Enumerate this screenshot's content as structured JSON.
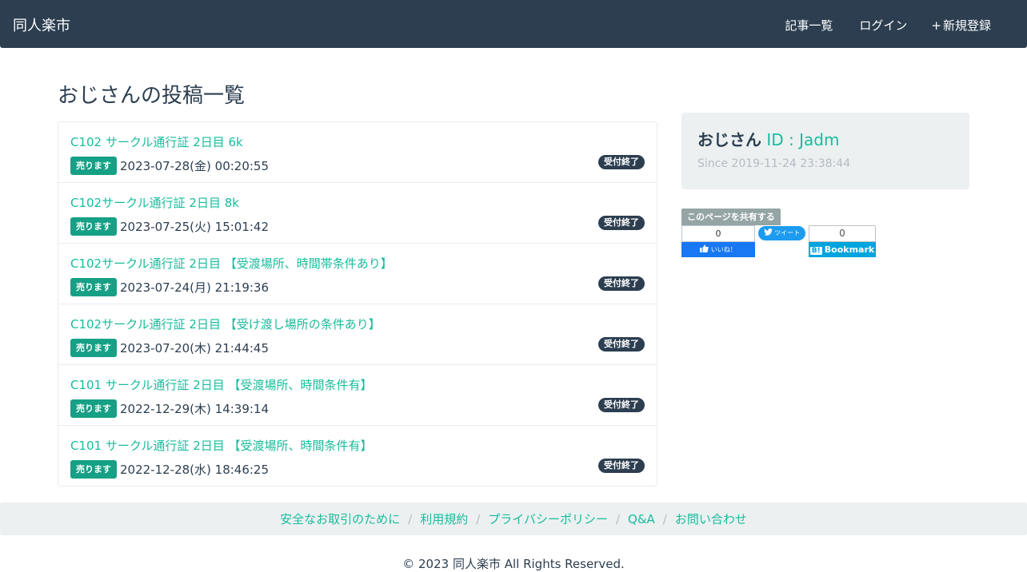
{
  "navbar": {
    "brand": "同人楽市",
    "items": [
      {
        "icon": "",
        "label": "記事一覧"
      },
      {
        "icon": "",
        "label": "ログイン"
      },
      {
        "icon": "+",
        "label": "新規登録"
      }
    ]
  },
  "page_title": "おじさんの投稿一覧",
  "posts": [
    {
      "title": "C102 サークル通行証 2日目 6k",
      "type_badge": "売ります",
      "date": "2023-07-28(金) 00:20:55",
      "status": "受付終了"
    },
    {
      "title": "C102サークル通行証 2日目 8k",
      "type_badge": "売ります",
      "date": "2023-07-25(火) 15:01:42",
      "status": "受付終了"
    },
    {
      "title": "C102サークル通行証 2日目 【受渡場所、時間帯条件あり】",
      "type_badge": "売ります",
      "date": "2023-07-24(月) 21:19:36",
      "status": "受付終了"
    },
    {
      "title": "C102サークル通行証 2日目 【受け渡し場所の条件あり】",
      "type_badge": "売ります",
      "date": "2023-07-20(木) 21:44:45",
      "status": "受付終了"
    },
    {
      "title": "C101 サークル通行証 2日目 【受渡場所、時間条件有】",
      "type_badge": "売ります",
      "date": "2022-12-29(木) 14:39:14",
      "status": "受付終了"
    },
    {
      "title": "C101 サークル通行証 2日目 【受渡場所、時間条件有】",
      "type_badge": "売ります",
      "date": "2022-12-28(水) 18:46:25",
      "status": "受付終了"
    }
  ],
  "profile": {
    "user_icon": "",
    "name": "おじさん",
    "id_label": " ID : Jadm",
    "since_icon": "",
    "since": "Since 2019-11-24 23:38:44"
  },
  "share": {
    "label": "このページを共有する",
    "facebook_count": "0",
    "facebook_button": "いいね！",
    "twitter_button": "ツイート",
    "hatena_count": "0",
    "hatena_mark": "B!",
    "hatena_button": "Bookmark"
  },
  "footer": {
    "links": [
      "安全なお取引のために",
      "利用規約",
      "プライバシーポリシー",
      "Q&A",
      "お問い合わせ"
    ],
    "separator": "/",
    "copyright": "© 2023 同人楽市 All Rights Reserved."
  },
  "colors": {
    "navbar": "#2c3e50",
    "accent": "#18bc9c",
    "sell_badge": "#16a085",
    "status_badge": "#2c3e50",
    "card_bg": "#ecf0f1"
  }
}
